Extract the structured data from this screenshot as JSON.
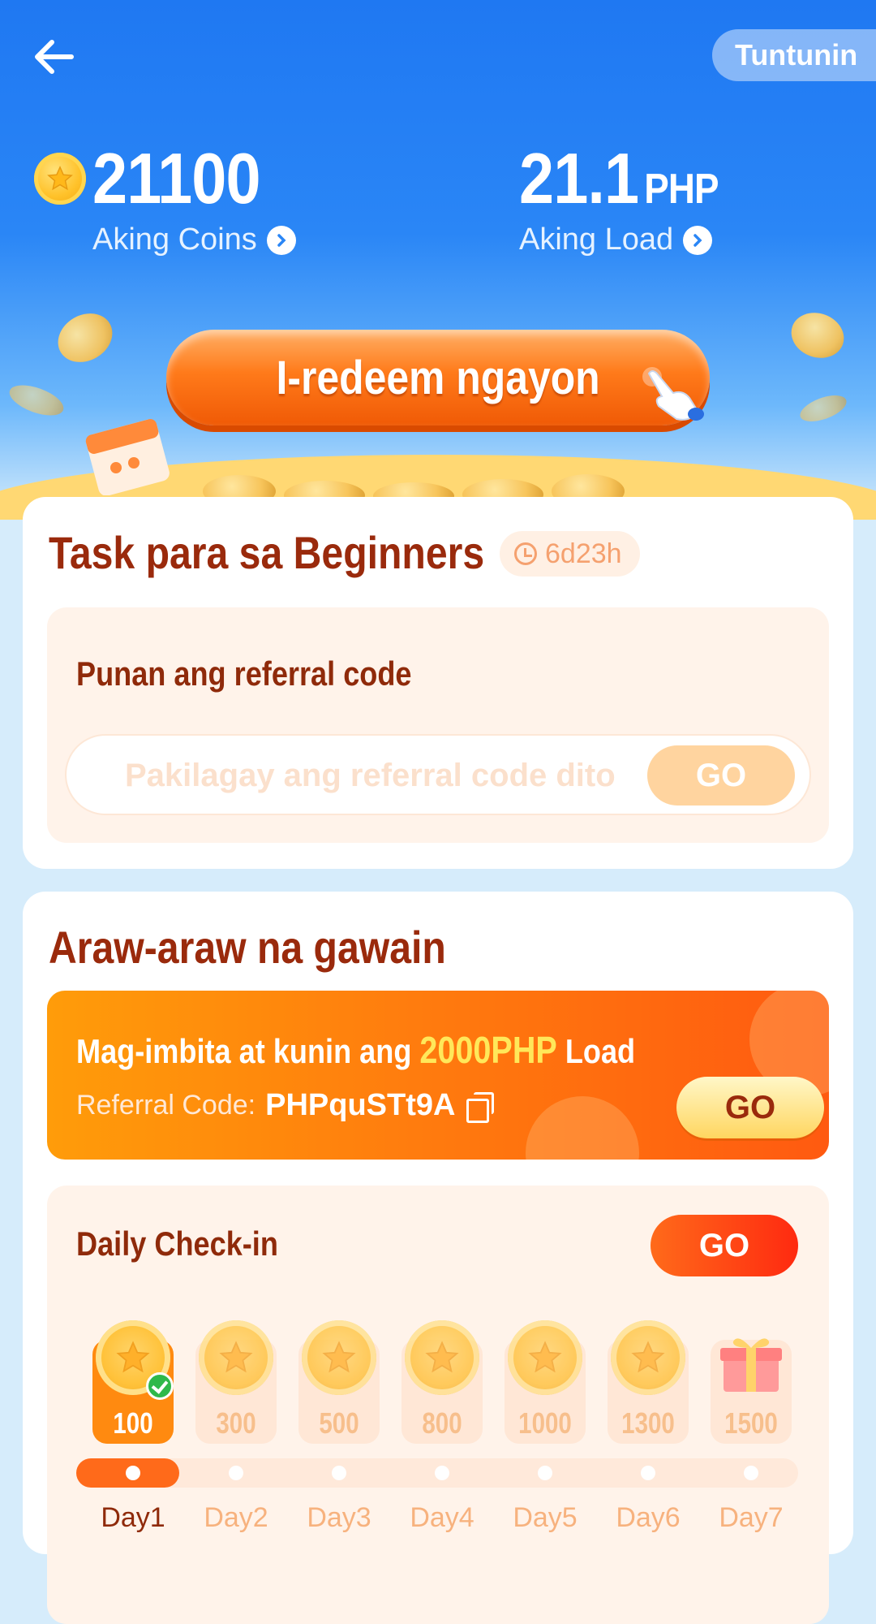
{
  "header": {
    "back_icon": "arrow-left-icon",
    "rules_label": "Tuntunin",
    "coins_value": "21100",
    "coins_label": "Aking Coins",
    "load_value": "21.1",
    "load_unit": "PHP",
    "load_label": "Aking Load",
    "redeem_label": "I-redeem ngayon"
  },
  "beginners": {
    "title": "Task para sa Beginners",
    "timer": "6d23h",
    "referral_title": "Punan ang referral code",
    "referral_placeholder": "Pakilagay ang referral code dito",
    "go_label": "GO"
  },
  "daily": {
    "title": "Araw-araw na gawain",
    "invite_prefix": "Mag-imbita at kunin ang ",
    "invite_highlight": "2000PHP",
    "invite_suffix": " Load",
    "ref_code_label": "Referral Code:",
    "ref_code": "PHPquSTt9A",
    "invite_go": "GO",
    "checkin_title": "Daily Check-in",
    "checkin_go": "GO",
    "days": [
      {
        "amount": "100",
        "label": "Day1",
        "checked": true
      },
      {
        "amount": "300",
        "label": "Day2",
        "checked": false
      },
      {
        "amount": "500",
        "label": "Day3",
        "checked": false
      },
      {
        "amount": "800",
        "label": "Day4",
        "checked": false
      },
      {
        "amount": "1000",
        "label": "Day5",
        "checked": false
      },
      {
        "amount": "1300",
        "label": "Day6",
        "checked": false
      },
      {
        "amount": "1500",
        "label": "Day7",
        "checked": false,
        "gift": true
      }
    ],
    "progress_days_completed": 1
  },
  "colors": {
    "header_blue": "#1f78f2",
    "title_brown": "#9a2a0c",
    "accent_orange": "#ff7a0e",
    "highlight_yellow": "#ffe85a"
  }
}
